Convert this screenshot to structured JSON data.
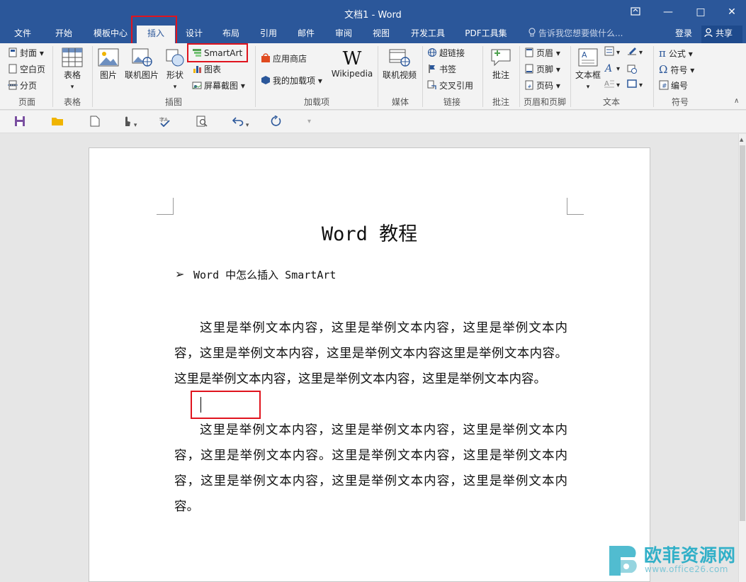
{
  "titlebar": {
    "title": "文档1 - Word",
    "ribbon_options_icon": "ribbon-display-icon",
    "minimize": "—",
    "maximize": "□",
    "close": "✕"
  },
  "tabs": [
    {
      "label": "文件"
    },
    {
      "label": "开始"
    },
    {
      "label": "模板中心"
    },
    {
      "label": "插入"
    },
    {
      "label": "设计"
    },
    {
      "label": "布局"
    },
    {
      "label": "引用"
    },
    {
      "label": "邮件"
    },
    {
      "label": "审阅"
    },
    {
      "label": "视图"
    },
    {
      "label": "开发工具"
    },
    {
      "label": "PDF工具集"
    }
  ],
  "active_tab": "插入",
  "tell_me": "告诉我您想要做什么...",
  "login": "登录",
  "share": "共享",
  "ribbon": {
    "pages": {
      "cover": "封面",
      "blank": "空白页",
      "break": "分页",
      "label": "页面"
    },
    "table": {
      "table": "表格",
      "label": "表格"
    },
    "illustrations": {
      "picture": "图片",
      "online_picture": "联机图片",
      "shapes": "形状",
      "smartart": "SmartArt",
      "chart": "图表",
      "screenshot": "屏幕截图",
      "label": "插图"
    },
    "addins": {
      "store": "应用商店",
      "my_addins": "我的加载项",
      "wikipedia": "Wikipedia",
      "label": "加载项"
    },
    "media": {
      "online_video": "联机视频",
      "label": "媒体"
    },
    "links": {
      "hyperlink": "超链接",
      "bookmark": "书签",
      "cross_ref": "交叉引用",
      "label": "链接"
    },
    "comments": {
      "comment": "批注",
      "label": "批注"
    },
    "header_footer": {
      "header": "页眉",
      "footer": "页脚",
      "page_number": "页码",
      "label": "页眉和页脚"
    },
    "text": {
      "textbox": "文本框",
      "label": "文本"
    },
    "symbols": {
      "equation": "公式",
      "symbol": "符号",
      "number": "编号",
      "label": "符号"
    }
  },
  "document": {
    "title": "Word 教程",
    "bullet_text": "Word 中怎么插入 SmartArt",
    "paragraph1": "这里是举例文本内容，这里是举例文本内容，这里是举例文本内容，这里是举例文本内容，这里是举例文本内容这里是举例文本内容。这里是举例文本内容，这里是举例文本内容，这里是举例文本内容。",
    "paragraph2": "这里是举例文本内容，这里是举例文本内容，这里是举例文本内容，这里是举例文本内容。这里是举例文本内容，这里是举例文本内容，这里是举例文本内容，这里是举例文本内容，这里是举例文本内容。"
  },
  "watermark": {
    "name": "欧菲资源网",
    "url": "www.office26.com"
  },
  "colors": {
    "accent": "#2b579a",
    "highlight": "#e0141e",
    "watermark": "#32b0c8"
  }
}
